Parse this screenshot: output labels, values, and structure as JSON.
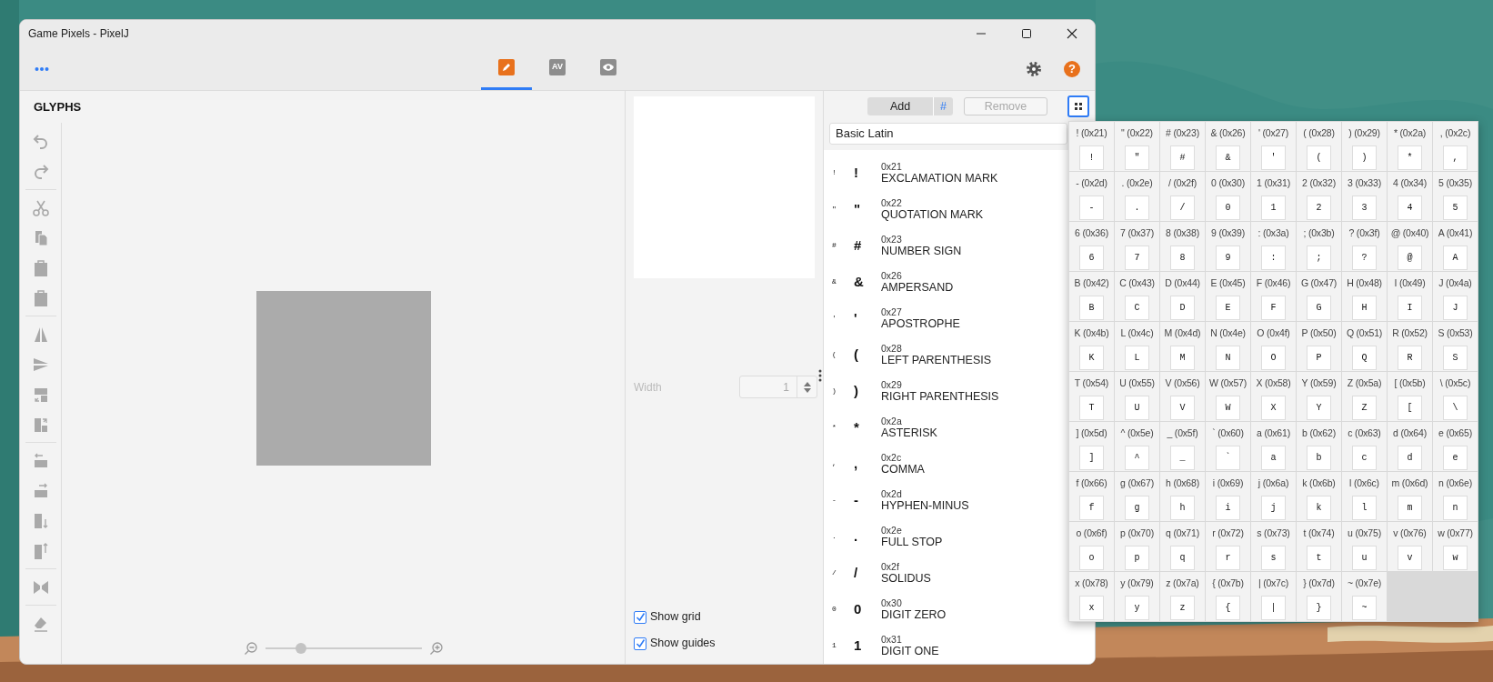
{
  "window": {
    "title": "Game Pixels - PixelJ"
  },
  "toolbar": {
    "tabs": [
      {
        "kind": "pencil",
        "selected": true
      },
      {
        "kind": "text",
        "label": "AV",
        "selected": false
      },
      {
        "kind": "eye",
        "selected": false
      }
    ],
    "help_label": "?"
  },
  "glyphs_panel": {
    "title": "GLYPHS",
    "tool_groups": [
      [
        {
          "kind": "undo",
          "disabled": true
        },
        {
          "kind": "redo",
          "disabled": true
        }
      ],
      [
        {
          "kind": "cut",
          "disabled": true
        },
        {
          "kind": "copy",
          "disabled": true
        },
        {
          "kind": "paste",
          "disabled": true
        },
        {
          "kind": "paste",
          "disabled": true
        }
      ],
      [
        {
          "kind": "flip_h",
          "disabled": true
        },
        {
          "kind": "flip_v",
          "disabled": true
        },
        {
          "kind": "rotate_ccw",
          "disabled": true
        },
        {
          "kind": "rotate_cw",
          "disabled": true
        }
      ],
      [
        {
          "kind": "shift_left",
          "disabled": true
        },
        {
          "kind": "shift_right",
          "disabled": true
        },
        {
          "kind": "shift_down",
          "disabled": true
        },
        {
          "kind": "shift_up",
          "disabled": true
        }
      ],
      [
        {
          "kind": "mirror",
          "disabled": true
        }
      ],
      [
        {
          "kind": "eraser",
          "disabled": true
        }
      ]
    ],
    "zoom": {
      "level": 0.23
    }
  },
  "properties": {
    "width_label": "Width",
    "width_value": "1",
    "width_disabled": true,
    "checkboxes": [
      {
        "label": "Show grid",
        "checked": true
      },
      {
        "label": "Show guides",
        "checked": true
      }
    ]
  },
  "glyph_list": {
    "add_label": "Add",
    "add_hash": "#",
    "remove_label": "Remove",
    "remove_disabled": true,
    "grid_view_selected": true,
    "block": "Basic Latin",
    "items": [
      {
        "preview": "!",
        "char": "!",
        "code": "0x21",
        "name": "EXCLAMATION MARK"
      },
      {
        "preview": "\"",
        "char": "\"",
        "code": "0x22",
        "name": "QUOTATION MARK"
      },
      {
        "preview": "#",
        "char": "#",
        "code": "0x23",
        "name": "NUMBER SIGN"
      },
      {
        "preview": "&",
        "char": "&",
        "code": "0x26",
        "name": "AMPERSAND"
      },
      {
        "preview": "'",
        "char": "'",
        "code": "0x27",
        "name": "APOSTROPHE"
      },
      {
        "preview": "(",
        "char": "(",
        "code": "0x28",
        "name": "LEFT PARENTHESIS"
      },
      {
        "preview": ")",
        "char": ")",
        "code": "0x29",
        "name": "RIGHT PARENTHESIS"
      },
      {
        "preview": "*",
        "char": "*",
        "code": "0x2a",
        "name": "ASTERISK"
      },
      {
        "preview": ",",
        "char": ",",
        "code": "0x2c",
        "name": "COMMA"
      },
      {
        "preview": "-",
        "char": "-",
        "code": "0x2d",
        "name": "HYPHEN-MINUS"
      },
      {
        "preview": ".",
        "char": ".",
        "code": "0x2e",
        "name": "FULL STOP"
      },
      {
        "preview": "/",
        "char": "/",
        "code": "0x2f",
        "name": "SOLIDUS"
      },
      {
        "preview": "0",
        "char": "0",
        "code": "0x30",
        "name": "DIGIT ZERO"
      },
      {
        "preview": "1",
        "char": "1",
        "code": "0x31",
        "name": "DIGIT ONE"
      }
    ]
  },
  "glyph_grid": {
    "cells": [
      {
        "label": "! (0x21)",
        "glyph": "!"
      },
      {
        "label": "\" (0x22)",
        "glyph": "\""
      },
      {
        "label": "# (0x23)",
        "glyph": "#"
      },
      {
        "label": "& (0x26)",
        "glyph": "&"
      },
      {
        "label": "' (0x27)",
        "glyph": "'"
      },
      {
        "label": "( (0x28)",
        "glyph": "("
      },
      {
        "label": ") (0x29)",
        "glyph": ")"
      },
      {
        "label": "* (0x2a)",
        "glyph": "*"
      },
      {
        "label": ", (0x2c)",
        "glyph": ","
      },
      {
        "label": "- (0x2d)",
        "glyph": "-"
      },
      {
        "label": ". (0x2e)",
        "glyph": "."
      },
      {
        "label": "/ (0x2f)",
        "glyph": "/"
      },
      {
        "label": "0 (0x30)",
        "glyph": "0"
      },
      {
        "label": "1 (0x31)",
        "glyph": "1"
      },
      {
        "label": "2 (0x32)",
        "glyph": "2"
      },
      {
        "label": "3 (0x33)",
        "glyph": "3"
      },
      {
        "label": "4 (0x34)",
        "glyph": "4"
      },
      {
        "label": "5 (0x35)",
        "glyph": "5"
      },
      {
        "label": "6 (0x36)",
        "glyph": "6"
      },
      {
        "label": "7 (0x37)",
        "glyph": "7"
      },
      {
        "label": "8 (0x38)",
        "glyph": "8"
      },
      {
        "label": "9 (0x39)",
        "glyph": "9"
      },
      {
        "label": ": (0x3a)",
        "glyph": ":"
      },
      {
        "label": "; (0x3b)",
        "glyph": ";"
      },
      {
        "label": "? (0x3f)",
        "glyph": "?"
      },
      {
        "label": "@ (0x40)",
        "glyph": "@"
      },
      {
        "label": "A (0x41)",
        "glyph": "A"
      },
      {
        "label": "B (0x42)",
        "glyph": "B"
      },
      {
        "label": "C (0x43)",
        "glyph": "C"
      },
      {
        "label": "D (0x44)",
        "glyph": "D"
      },
      {
        "label": "E (0x45)",
        "glyph": "E"
      },
      {
        "label": "F (0x46)",
        "glyph": "F"
      },
      {
        "label": "G (0x47)",
        "glyph": "G"
      },
      {
        "label": "H (0x48)",
        "glyph": "H"
      },
      {
        "label": "I (0x49)",
        "glyph": "I"
      },
      {
        "label": "J (0x4a)",
        "glyph": "J"
      },
      {
        "label": "K (0x4b)",
        "glyph": "K"
      },
      {
        "label": "L (0x4c)",
        "glyph": "L"
      },
      {
        "label": "M (0x4d)",
        "glyph": "M"
      },
      {
        "label": "N (0x4e)",
        "glyph": "N"
      },
      {
        "label": "O (0x4f)",
        "glyph": "O"
      },
      {
        "label": "P (0x50)",
        "glyph": "P"
      },
      {
        "label": "Q (0x51)",
        "glyph": "Q"
      },
      {
        "label": "R (0x52)",
        "glyph": "R"
      },
      {
        "label": "S (0x53)",
        "glyph": "S"
      },
      {
        "label": "T (0x54)",
        "glyph": "T"
      },
      {
        "label": "U (0x55)",
        "glyph": "U"
      },
      {
        "label": "V (0x56)",
        "glyph": "V"
      },
      {
        "label": "W (0x57)",
        "glyph": "W"
      },
      {
        "label": "X (0x58)",
        "glyph": "X"
      },
      {
        "label": "Y (0x59)",
        "glyph": "Y"
      },
      {
        "label": "Z (0x5a)",
        "glyph": "Z"
      },
      {
        "label": "[ (0x5b)",
        "glyph": "["
      },
      {
        "label": "\\ (0x5c)",
        "glyph": "\\"
      },
      {
        "label": "] (0x5d)",
        "glyph": "]"
      },
      {
        "label": "^ (0x5e)",
        "glyph": "^"
      },
      {
        "label": "_ (0x5f)",
        "glyph": "_"
      },
      {
        "label": "` (0x60)",
        "glyph": "`"
      },
      {
        "label": "a (0x61)",
        "glyph": "a"
      },
      {
        "label": "b (0x62)",
        "glyph": "b"
      },
      {
        "label": "c (0x63)",
        "glyph": "c"
      },
      {
        "label": "d (0x64)",
        "glyph": "d"
      },
      {
        "label": "e (0x65)",
        "glyph": "e"
      },
      {
        "label": "f (0x66)",
        "glyph": "f"
      },
      {
        "label": "g (0x67)",
        "glyph": "g"
      },
      {
        "label": "h (0x68)",
        "glyph": "h"
      },
      {
        "label": "i (0x69)",
        "glyph": "i"
      },
      {
        "label": "j (0x6a)",
        "glyph": "j"
      },
      {
        "label": "k (0x6b)",
        "glyph": "k"
      },
      {
        "label": "l (0x6c)",
        "glyph": "l"
      },
      {
        "label": "m (0x6d)",
        "glyph": "m"
      },
      {
        "label": "n (0x6e)",
        "glyph": "n"
      },
      {
        "label": "o (0x6f)",
        "glyph": "o"
      },
      {
        "label": "p (0x70)",
        "glyph": "p"
      },
      {
        "label": "q (0x71)",
        "glyph": "q"
      },
      {
        "label": "r (0x72)",
        "glyph": "r"
      },
      {
        "label": "s (0x73)",
        "glyph": "s"
      },
      {
        "label": "t (0x74)",
        "glyph": "t"
      },
      {
        "label": "u (0x75)",
        "glyph": "u"
      },
      {
        "label": "v (0x76)",
        "glyph": "v"
      },
      {
        "label": "w (0x77)",
        "glyph": "w"
      },
      {
        "label": "x (0x78)",
        "glyph": "x"
      },
      {
        "label": "y (0x79)",
        "glyph": "y"
      },
      {
        "label": "z (0x7a)",
        "glyph": "z"
      },
      {
        "label": "{ (0x7b)",
        "glyph": "{"
      },
      {
        "label": "| (0x7c)",
        "glyph": "|"
      },
      {
        "label": "} (0x7d)",
        "glyph": "}"
      },
      {
        "label": "~ (0x7e)",
        "glyph": "~"
      }
    ]
  }
}
